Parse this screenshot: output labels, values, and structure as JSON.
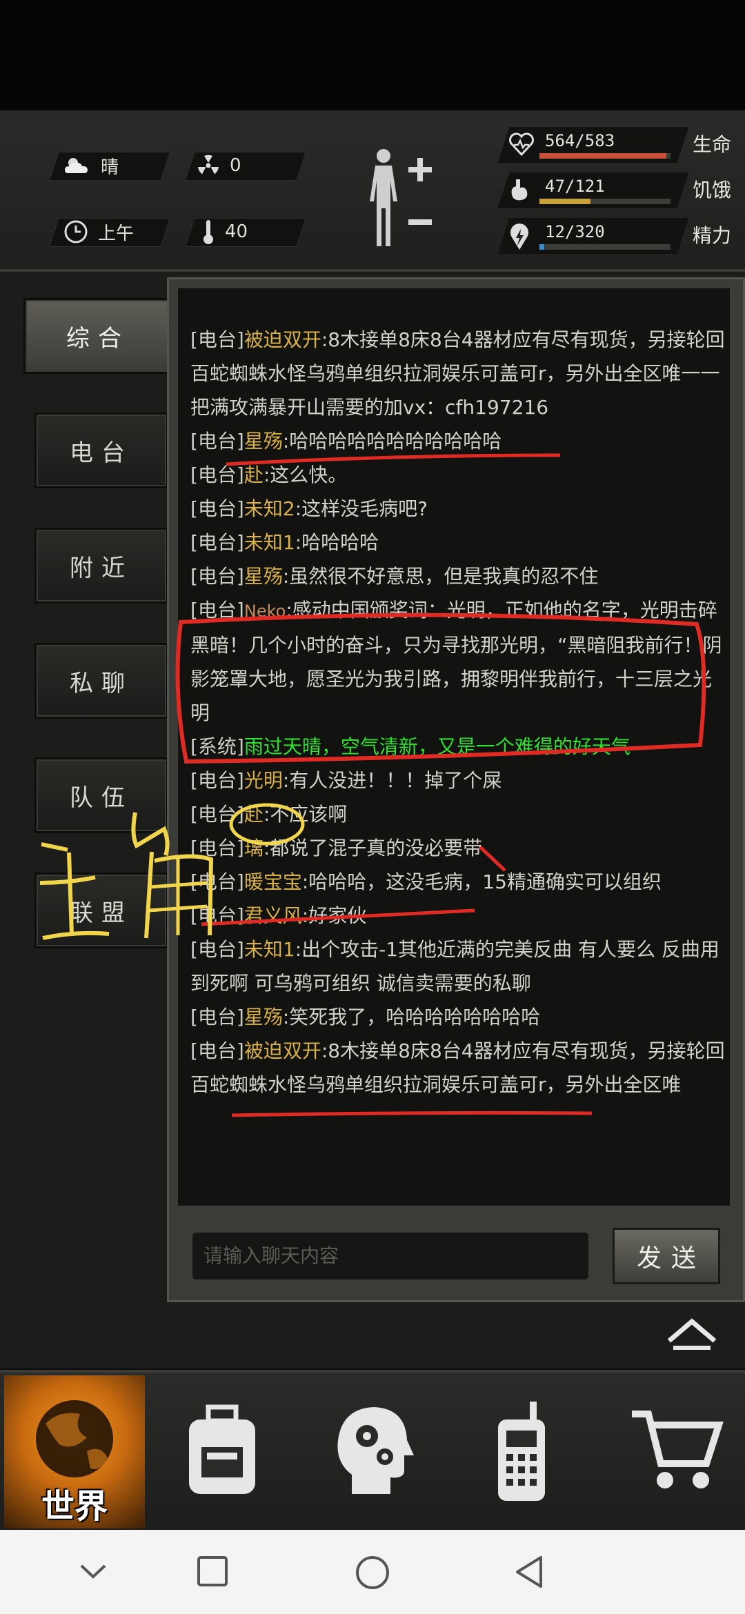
{
  "hud": {
    "weather": "晴",
    "radiation": "0",
    "time_of_day": "上午",
    "temperature": "40",
    "stats": [
      {
        "value": "564/583",
        "label": "生命",
        "fraction": 0.967,
        "color": "#c8503a"
      },
      {
        "value": "47/121",
        "label": "饥饿",
        "fraction": 0.388,
        "color": "#c8a040"
      },
      {
        "value": "12/320",
        "label": "精力",
        "fraction": 0.0375,
        "color": "#3a8ec8"
      }
    ]
  },
  "sidebar": {
    "tabs": [
      {
        "label": "综合",
        "active": true
      },
      {
        "label": "电台"
      },
      {
        "label": "附近"
      },
      {
        "label": "私聊"
      },
      {
        "label": "队伍"
      },
      {
        "label": "联盟"
      }
    ]
  },
  "chat": {
    "messages": [
      {
        "channel": "[电台]",
        "name": "被迫双开",
        "text": ":8木接单8床8台4器材应有尽有现货，另接轮回百蛇蜘蛛水怪乌鸦单组织拉洞娱乐可盖可r，另外出全区唯一一把满攻满暴开山需要的加vx：cfh197216"
      },
      {
        "channel": "[电台]",
        "name": "星殇",
        "text": ":哈哈哈哈哈哈哈哈哈哈哈"
      },
      {
        "channel": "[电台]",
        "name": "赴",
        "text": ":这么快。"
      },
      {
        "channel": "[电台]",
        "name": "未知2",
        "text": ":这样没毛病吧?"
      },
      {
        "channel": "[电台]",
        "name": "未知1",
        "text": ":哈哈哈哈"
      },
      {
        "channel": "[电台]",
        "name": "星殇",
        "text": ":虽然很不好意思，但是我真的忍不住"
      },
      {
        "channel": "[电台]",
        "name": "Neko",
        "text": ":感动中国颁奖词：光明，正如他的名字，光明击碎黑暗！几个小时的奋斗，只为寻找那光明，“黑暗阻我前行！阴影笼罩大地，愿圣光为我引路，拥黎明伴我前行，十三层之光明"
      },
      {
        "channel": "[系统]",
        "system": "雨过天晴，空气清新，又是一个难得的好天气"
      },
      {
        "channel": "[电台]",
        "name": "光明",
        "text": ":有人没进！！！掉了个屎"
      },
      {
        "channel": "[电台]",
        "name": "赴",
        "text": ":不应该啊"
      },
      {
        "channel": "[电台]",
        "name": "璃",
        "text": ":都说了混子真的没必要带"
      },
      {
        "channel": "[电台]",
        "name": "暖宝宝",
        "text": ":哈哈哈，这没毛病，15精通确实可以组织"
      },
      {
        "channel": "[电台]",
        "name": "君义风",
        "text": ":好家伙"
      },
      {
        "channel": "[电台]",
        "name": "未知1",
        "text": ":出个攻击-1其他近满的完美反曲 有人要么 反曲用到死啊 可乌鸦可组织 诚信卖需要的私聊"
      },
      {
        "channel": "[电台]",
        "name": "星殇",
        "text": ":笑死我了，哈哈哈哈哈哈哈哈"
      },
      {
        "channel": "[电台]",
        "name": "被迫双开",
        "text": ":8木接单8床8台4器材应有尽有现货，另接轮回百蛇蜘蛛水怪乌鸦单组织拉洞娱乐可盖可r，另外出全区唯"
      }
    ],
    "input_placeholder": "请输入聊天内容",
    "send_label": "发送"
  },
  "annotation": {
    "handwritten_text": "主角"
  },
  "bottom_nav": {
    "world_label": "世界",
    "items": [
      "backpack-icon",
      "skills-head-icon",
      "radio-icon",
      "shop-cart-icon"
    ]
  }
}
